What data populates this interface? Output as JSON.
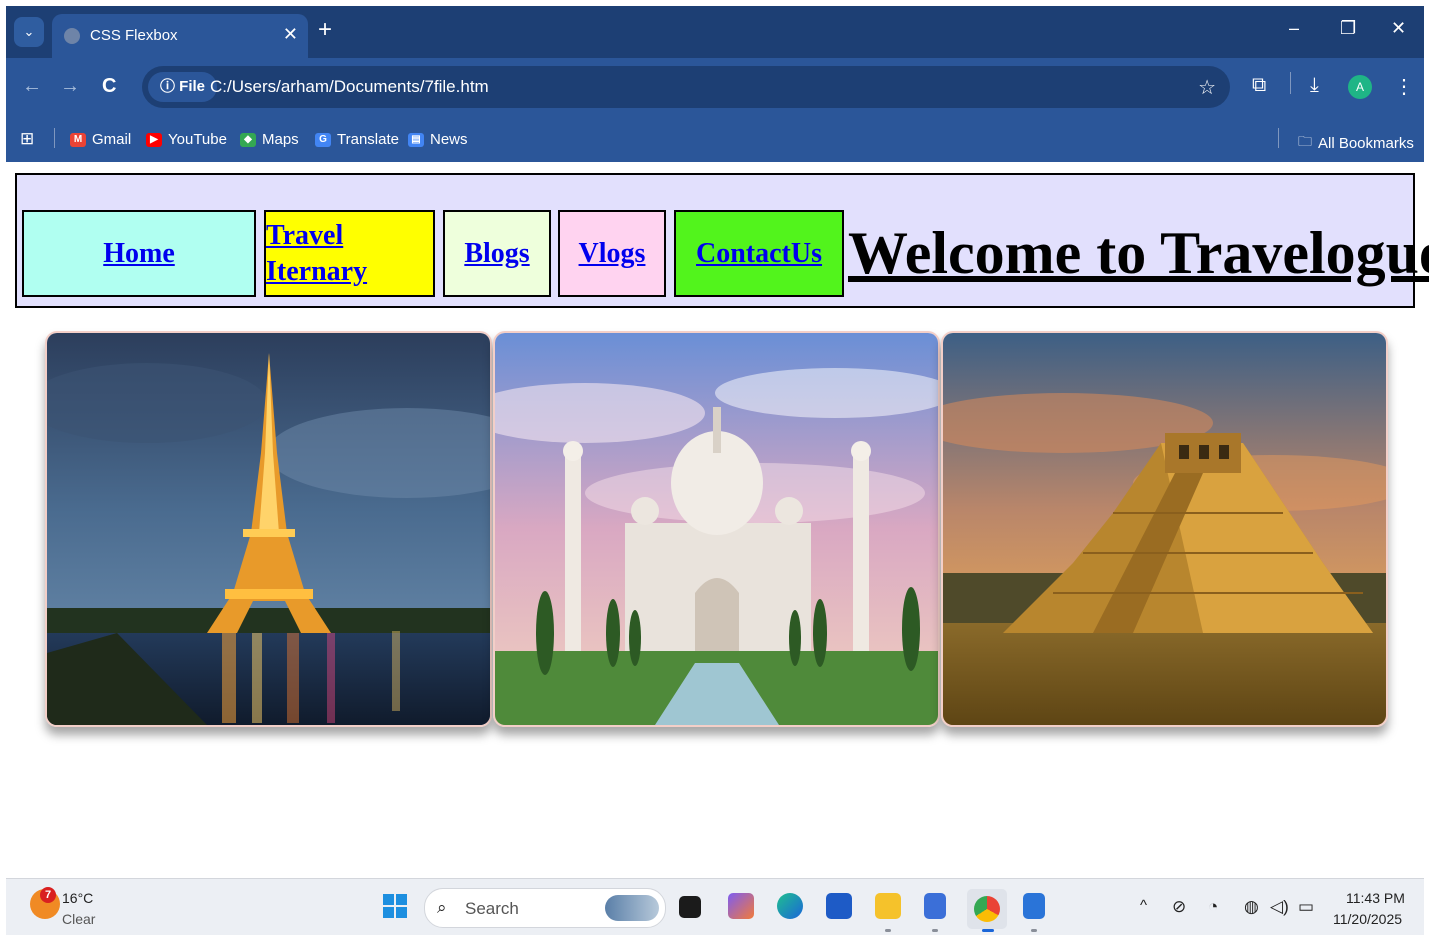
{
  "browser": {
    "tab_title": "CSS Flexbox",
    "tab_close": "✕",
    "new_tab": "+",
    "window_controls": {
      "minimize": "–",
      "restore": "❐",
      "close": "✕"
    },
    "nav": {
      "back": "←",
      "forward": "→",
      "reload": "C"
    },
    "address": {
      "chip_label": "ⓘ File",
      "url": "C:/Users/arham/Documents/7file.htm"
    },
    "profile_initial": "A",
    "bookmarks": [
      {
        "label": "Gmail",
        "icon": "gmail-icon",
        "color": "#ea4335",
        "glyph": "M"
      },
      {
        "label": "YouTube",
        "icon": "youtube-icon",
        "color": "#ff0000",
        "glyph": "▶"
      },
      {
        "label": "Maps",
        "icon": "maps-icon",
        "color": "#34a853",
        "glyph": "◆"
      },
      {
        "label": "Translate",
        "icon": "translate-icon",
        "color": "#4285f4",
        "glyph": "G"
      },
      {
        "label": "News",
        "icon": "news-icon",
        "color": "#4285f4",
        "glyph": "▤"
      }
    ],
    "all_bookmarks": "All Bookmarks"
  },
  "page": {
    "nav": [
      {
        "label": "Home",
        "bg": "#b0fff1"
      },
      {
        "label": "Travel Iternary",
        "bg": "#ffff00"
      },
      {
        "label": "Blogs",
        "bg": "#eeffdc"
      },
      {
        "label": "Vlogs",
        "bg": "#ffd3f0"
      },
      {
        "label": "ContactUs",
        "bg": "#52f41c"
      }
    ],
    "headline": "Welcome to Travelogue!!",
    "cards": [
      {
        "subject": "eiffel-tower-image"
      },
      {
        "subject": "taj-mahal-image"
      },
      {
        "subject": "chichen-itza-pyramid-image"
      }
    ]
  },
  "taskbar": {
    "weather": {
      "temp": "16°C",
      "condition": "Clear",
      "badge": "7"
    },
    "search_label": "Search",
    "clock": {
      "time": "11:43 PM",
      "date": "11/20/2025"
    }
  }
}
